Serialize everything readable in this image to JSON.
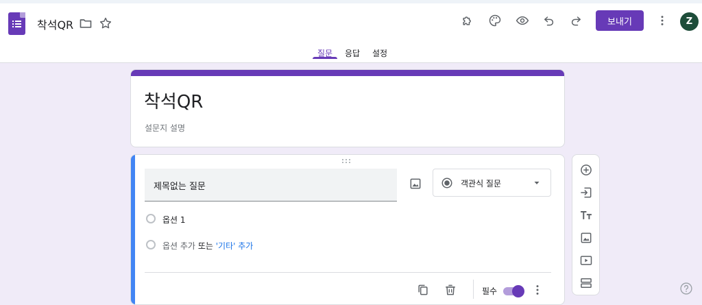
{
  "header": {
    "title": "착석QR",
    "send_label": "보내기",
    "avatar_letter": "Z",
    "icons": [
      "forms-logo-icon",
      "folder-icon",
      "star-icon",
      "addon-puzzle-icon",
      "palette-icon",
      "preview-eye-icon",
      "undo-icon",
      "redo-icon",
      "more-vert-icon"
    ]
  },
  "tabs": [
    {
      "label": "질문",
      "active": true
    },
    {
      "label": "응답",
      "active": false
    },
    {
      "label": "설정",
      "active": false
    }
  ],
  "form": {
    "title": "착석QR",
    "description": "설문지 설명"
  },
  "question": {
    "title": "제목없는 질문",
    "type_label": "객관식 질문",
    "options": [
      "옵션 1"
    ],
    "add_option": {
      "text": "옵션 추가",
      "or": "또는",
      "other": "'기타' 추가"
    },
    "required_label": "필수",
    "required_on": true
  },
  "colors": {
    "accent": "#673ab7",
    "active_bar": "#4285f4",
    "background": "#f0ebf8",
    "link": "#1a73e8"
  }
}
